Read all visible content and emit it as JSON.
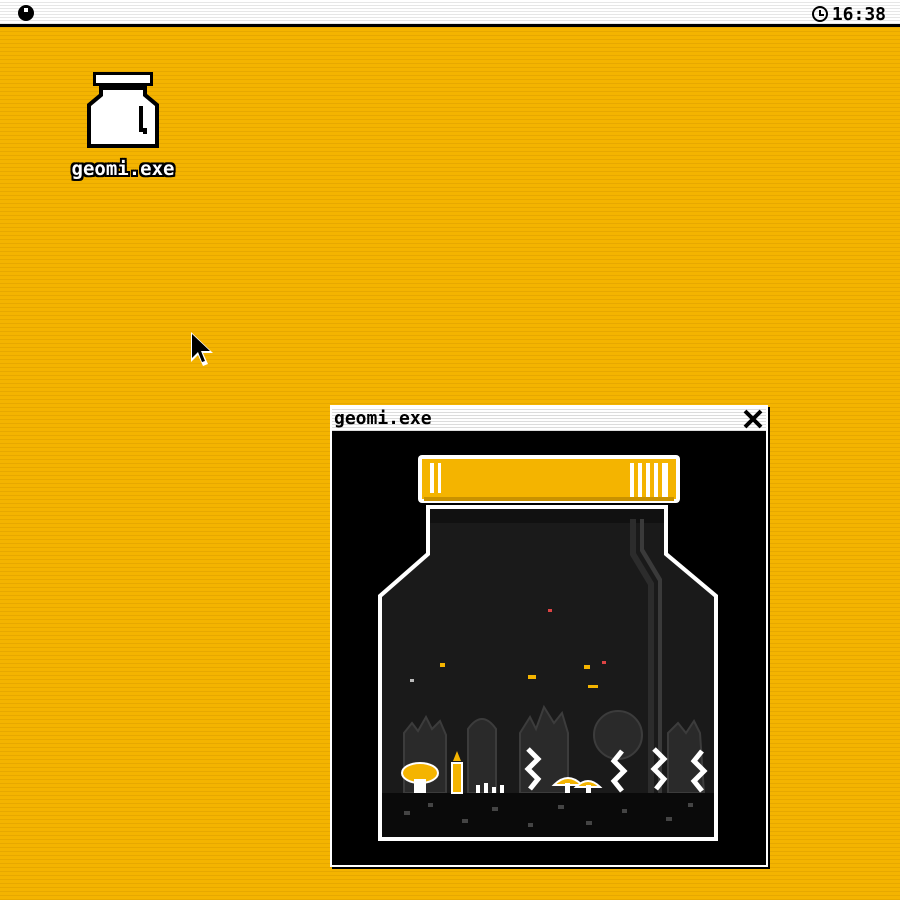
{
  "menubar": {
    "time": "16:38",
    "menu_icon": "circle-menu-icon",
    "clock_icon": "clock-icon"
  },
  "desktop": {
    "background_color": "#f4b400",
    "icons": [
      {
        "label": "geomi.exe",
        "icon": "jar-icon"
      }
    ]
  },
  "window": {
    "title": "geomi.exe",
    "close_icon": "close-icon",
    "content": "terrarium-jar-scene"
  },
  "colors": {
    "accent": "#f4b400",
    "window_bg": "#000000",
    "chrome": "#ffffff"
  }
}
